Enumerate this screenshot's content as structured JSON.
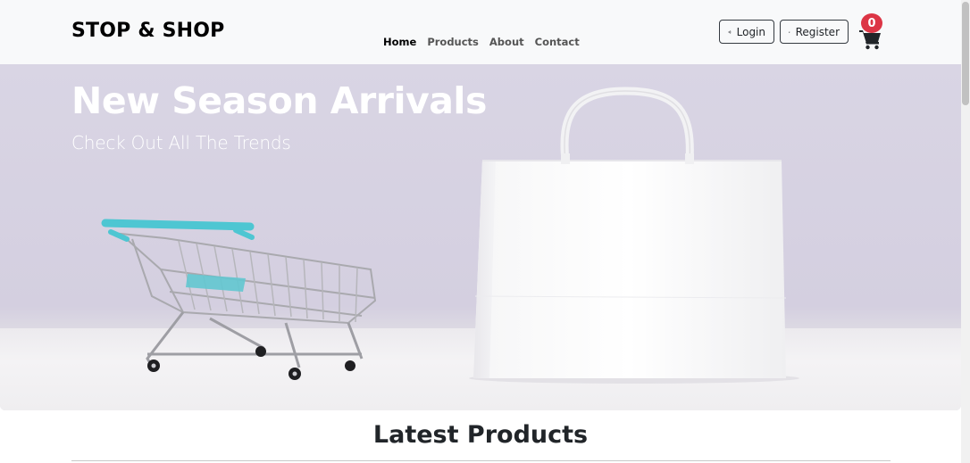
{
  "navbar": {
    "brand": "STOP & SHOP",
    "links": [
      {
        "label": "Home",
        "active": true
      },
      {
        "label": "Products",
        "active": false
      },
      {
        "label": "About",
        "active": false
      },
      {
        "label": "Contact",
        "active": false
      }
    ],
    "login_label": "Login",
    "register_label": "Register",
    "cart_count": "0",
    "icons": {
      "login": "sign-in-icon",
      "register": "user-plus-icon",
      "cart": "shopping-cart-icon"
    }
  },
  "hero": {
    "title": "New Season Arrivals",
    "subtitle": "Check Out All The Trends",
    "image": "shopping-cart-and-white-paper-bag"
  },
  "main": {
    "section_title": "Latest Products"
  },
  "colors": {
    "navbar_bg": "#f8f9fa",
    "badge": "#dc3545",
    "hero_bg": "#d6d1e1",
    "cart_accent": "#4ec6d2"
  }
}
